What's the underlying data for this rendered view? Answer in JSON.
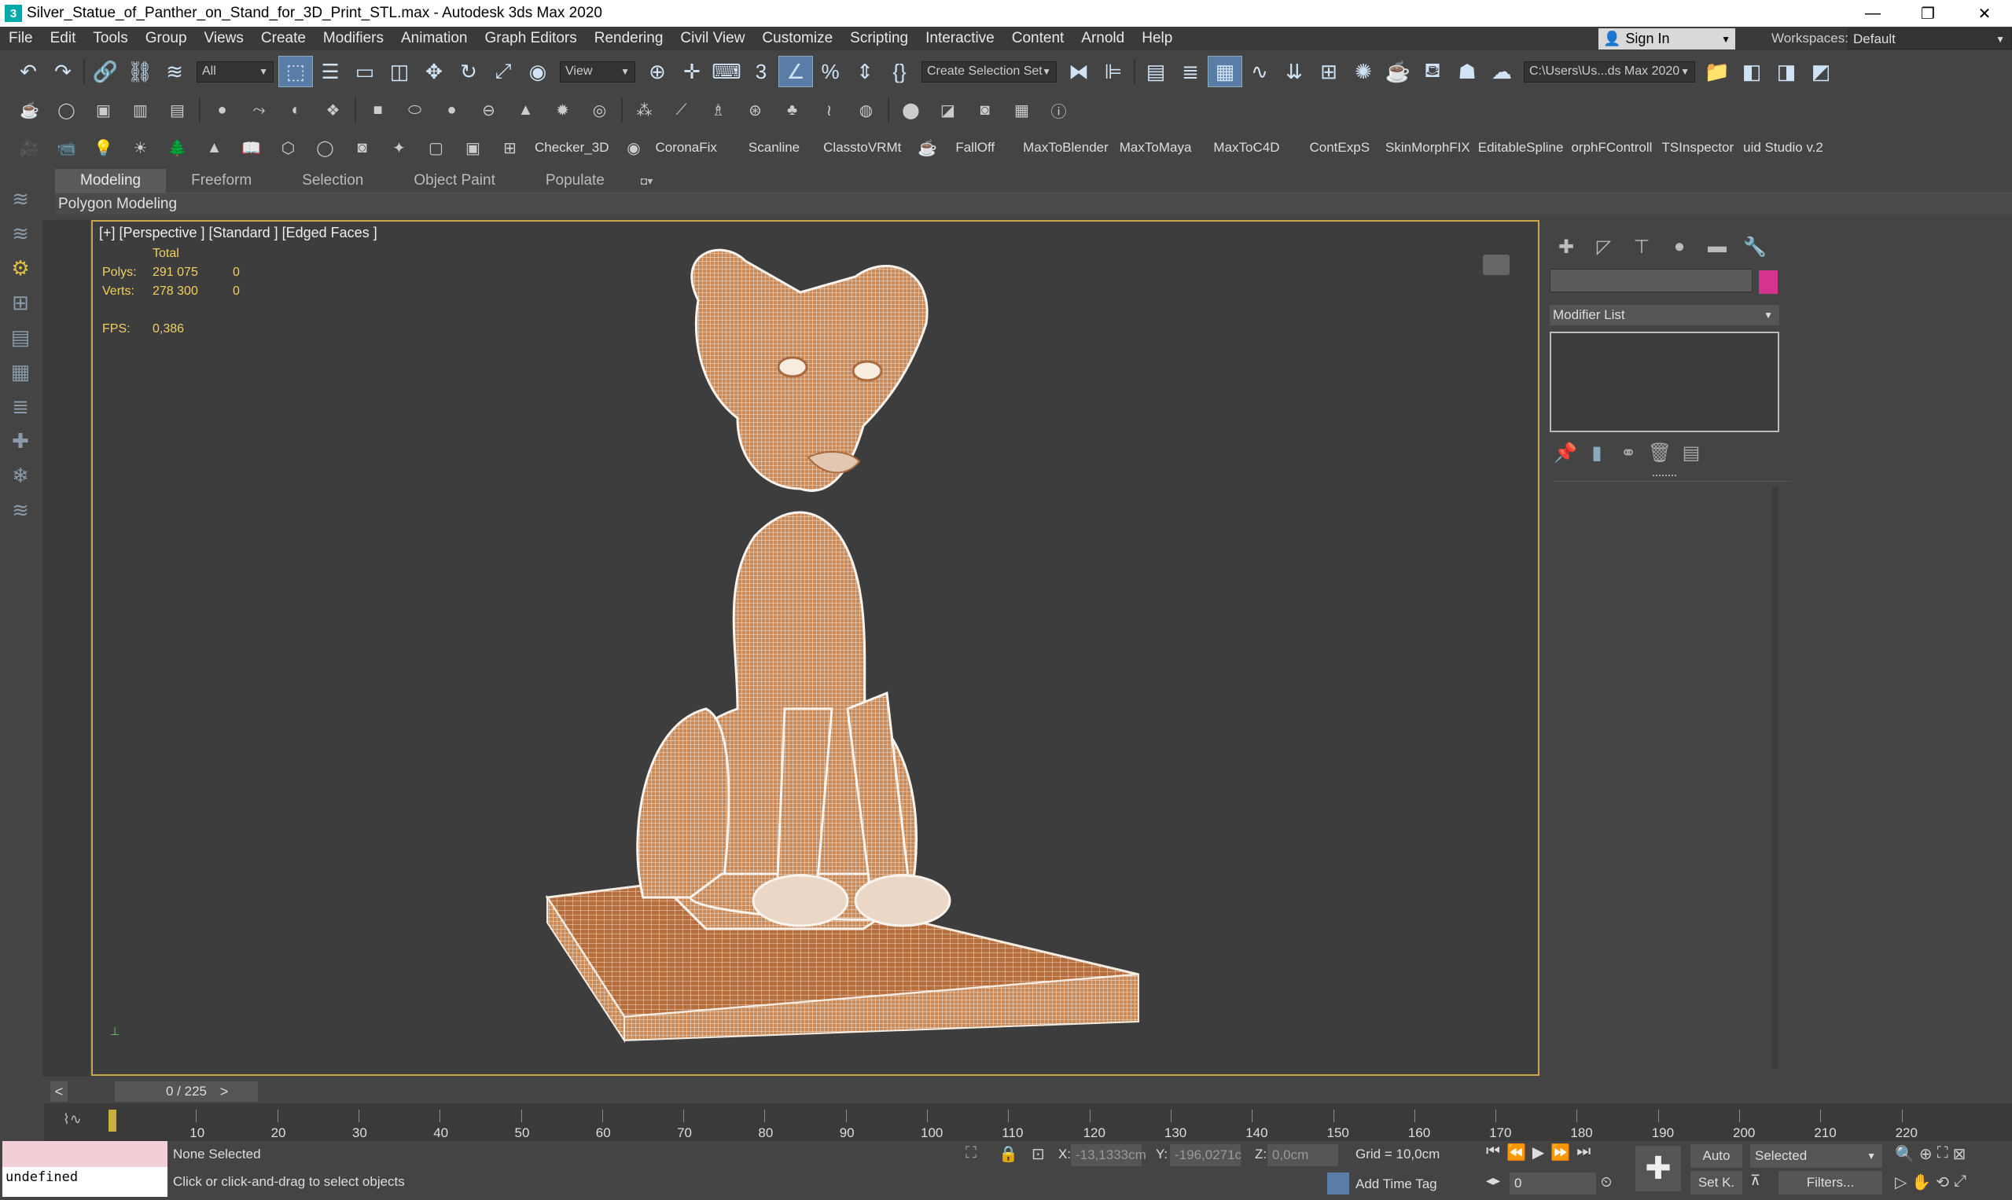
{
  "window": {
    "title": "Silver_Statue_of_Panther_on_Stand_for_3D_Print_STL.max - Autodesk 3ds Max 2020",
    "minimize": "—",
    "maximize": "❐",
    "close": "✕"
  },
  "menu": [
    "File",
    "Edit",
    "Tools",
    "Group",
    "Views",
    "Create",
    "Modifiers",
    "Animation",
    "Graph Editors",
    "Rendering",
    "Civil View",
    "Customize",
    "Scripting",
    "Interactive",
    "Content",
    "Arnold",
    "Help"
  ],
  "signin": {
    "label": "Sign In"
  },
  "workspaces": {
    "label": "Workspaces:",
    "value": "Default"
  },
  "toolbar1": {
    "filter": "All",
    "refcoord": "View",
    "selset": "Create Selection Set",
    "path": "C:\\Users\\Us...ds Max 2020"
  },
  "toolbar3": {
    "plugins": [
      "Checker_3D",
      "CoronaFix",
      "Scanline",
      "ClasstoVRMt",
      "FallOff",
      "MaxToBlender",
      "MaxToMaya",
      "MaxToC4D",
      "ContExpS",
      "SkinMorphFIX",
      "EditableSpline",
      "orphFControll",
      "TSInspector",
      "uid Studio v.2"
    ]
  },
  "ribbon": {
    "tabs": [
      "Modeling",
      "Freeform",
      "Selection",
      "Object Paint",
      "Populate"
    ],
    "panel": "Polygon Modeling"
  },
  "viewport": {
    "label": "[+] [Perspective ] [Standard ] [Edged Faces ]",
    "stats": {
      "total": "Total",
      "polys_label": "Polys:",
      "polys": "291 075",
      "polys_sel": "0",
      "verts_label": "Verts:",
      "verts": "278 300",
      "verts_sel": "0",
      "fps_label": "FPS:",
      "fps": "0,386"
    }
  },
  "command_panel": {
    "modifier_list": "Modifier List",
    "object_color": "#d4338f"
  },
  "time": {
    "slider": "0 / 225",
    "prev": "<",
    "next": ">",
    "ticks": [
      "10",
      "20",
      "30",
      "40",
      "50",
      "60",
      "70",
      "80",
      "90",
      "100",
      "110",
      "120",
      "130",
      "140",
      "150",
      "160",
      "170",
      "180",
      "190",
      "200",
      "210",
      "220"
    ]
  },
  "status": {
    "maxscript_out": "undefined",
    "selection": "None Selected",
    "prompt": "Click or click-and-drag to select objects",
    "x_label": "X:",
    "x": "-13,1333cm",
    "y_label": "Y:",
    "y": "-196,0271c",
    "z_label": "Z:",
    "z": "0,0cm",
    "grid": "Grid = 10,0cm",
    "add_time_tag": "Add Time Tag",
    "auto": "Auto",
    "setk": "Set K.",
    "selected": "Selected",
    "filters": "Filters...",
    "frame": "0"
  }
}
